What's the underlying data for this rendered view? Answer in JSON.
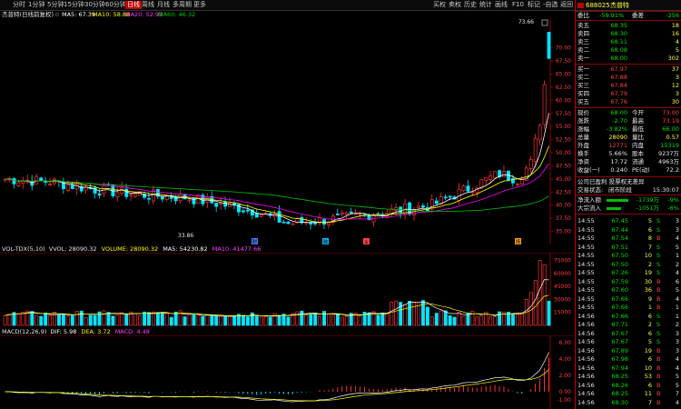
{
  "topbar": {
    "left": [
      "分时",
      "1分钟",
      "5分钟",
      "15分钟",
      "30分钟",
      "60分钟",
      "日线",
      "周线",
      "月线",
      "多周期",
      "更多"
    ],
    "selected": "日线",
    "right": [
      "买权",
      "卖权",
      "历史",
      "统计",
      "画线",
      "F10",
      "标记",
      "-自选",
      "返回"
    ]
  },
  "title": {
    "stock": "杰普特(日线前复权)",
    "ma5": "MA5: 67.39",
    "ma10": "MA10: 58.88",
    "ma20": "MA20: 52.93",
    "ma60": "MA60: 46.32"
  },
  "price_axis": [
    "70.00",
    "67.50",
    "65.00",
    "62.50",
    "60.00",
    "57.50",
    "55.00",
    "52.50",
    "50.00",
    "47.50",
    "45.00",
    "42.50",
    "40.00",
    "37.50",
    "35.00"
  ],
  "price_annotations": {
    "high": "73.66",
    "low": "33.86"
  },
  "markers": {
    "a": "财",
    "b": "融",
    "c": "$",
    "d": "扬"
  },
  "volume": {
    "label_main": "VOL-TDX(5,10)",
    "vvol": "VVOL: 28090.32",
    "volume": "VOLUME: 28090.32",
    "ma5": "MA5: 54230.82",
    "ma10": "MA10: 41477.66",
    "axis": [
      "75000",
      "60000",
      "45000",
      "30000",
      "15000"
    ]
  },
  "macd": {
    "label_main": "MACD(12,26,9)",
    "dif": "DIF: 5.98",
    "dea": "DEA: 3.72",
    "macd": "MACD: 4.48",
    "axis": [
      "6.00",
      "4.00",
      "2.00",
      "0.00",
      "-1.00"
    ]
  },
  "quote": {
    "code": "688025",
    "name": "杰普特",
    "webi_label": "委比",
    "webi_value": "-59.91%",
    "weicha_label": "委差",
    "weicha_value": "-256",
    "asks": [
      {
        "label": "卖五",
        "price": "68.35",
        "vol": "18"
      },
      {
        "label": "卖四",
        "price": "68.30",
        "vol": "16"
      },
      {
        "label": "卖三",
        "price": "68.11",
        "vol": "4"
      },
      {
        "label": "卖二",
        "price": "68.08",
        "vol": "5"
      },
      {
        "label": "卖一",
        "price": "68.00",
        "vol": "302"
      }
    ],
    "bids": [
      {
        "label": "买一",
        "price": "67.97",
        "vol": "37"
      },
      {
        "label": "买二",
        "price": "67.88",
        "vol": "3"
      },
      {
        "label": "买三",
        "price": "67.84",
        "vol": "12"
      },
      {
        "label": "买四",
        "price": "67.79",
        "vol": "3"
      },
      {
        "label": "买五",
        "price": "67.76",
        "vol": "30"
      }
    ],
    "stats": [
      {
        "l1": "现价",
        "v1": "68.00",
        "l2": "今开",
        "v2": "73.00"
      },
      {
        "l1": "涨跌",
        "v1": "-2.70",
        "l2": "最高",
        "v2": "73.19"
      },
      {
        "l1": "涨幅",
        "v1": "-3.82%",
        "l2": "最低",
        "v2": "66.00"
      },
      {
        "l1": "总量",
        "v1": "28090",
        "l2": "量比",
        "v2": "0.57"
      },
      {
        "l1": "外盘",
        "v1": "12771",
        "l2": "内盘",
        "v2": "15319"
      },
      {
        "l1": "换手",
        "v1": "5.66%",
        "l2": "股本",
        "v2": "9237万"
      },
      {
        "l1": "净资",
        "v1": "17.72",
        "l2": "流通",
        "v2": "4963万"
      },
      {
        "l1": "收益(一)",
        "v1": "0.240",
        "l2": "PE(动)",
        "v2": "72.2"
      }
    ],
    "notice": "公司已盈利 投票权无差异",
    "status_label": "交易状态:",
    "status": "闭市阶段",
    "status_time": "15:30:07",
    "inflow1_label": "净流入额",
    "inflow1_val": "-1739万",
    "inflow1_pct": "-9%",
    "inflow2_label": "大宗流入",
    "inflow2_val": "-1051万",
    "inflow2_pct": "-6%"
  },
  "ticks": [
    {
      "t": "14:55",
      "p": "67.45",
      "v": "5",
      "s": "S",
      "n": "3"
    },
    {
      "t": "14:55",
      "p": "67.44",
      "v": "6",
      "s": "S",
      "n": "3"
    },
    {
      "t": "14:55",
      "p": "67.54",
      "v": "8",
      "s": "B",
      "n": "4"
    },
    {
      "t": "14:55",
      "p": "67.51",
      "v": "7",
      "s": "S",
      "n": "5"
    },
    {
      "t": "14:55",
      "p": "67.50",
      "v": "10",
      "s": "S",
      "n": "1"
    },
    {
      "t": "14:55",
      "p": "67.50",
      "v": "2",
      "s": "S",
      "n": "2"
    },
    {
      "t": "14:55",
      "p": "67.26",
      "v": "19",
      "s": "S",
      "n": "4"
    },
    {
      "t": "14:55",
      "p": "67.59",
      "v": "30",
      "s": "B",
      "n": "6"
    },
    {
      "t": "14:55",
      "p": "67.60",
      "v": "36",
      "s": "B",
      "n": "5"
    },
    {
      "t": "14:55",
      "p": "67.66",
      "v": "9",
      "s": "B",
      "n": "4"
    },
    {
      "t": "14:55",
      "p": "67.66",
      "v": "1",
      "s": "B",
      "n": "1"
    },
    {
      "t": "14:56",
      "p": "67.66",
      "v": "6",
      "s": "S",
      "n": "1"
    },
    {
      "t": "14:56",
      "p": "67.71",
      "v": "2",
      "s": "S",
      "n": "2"
    },
    {
      "t": "14:56",
      "p": "67.67",
      "v": "6",
      "s": "S",
      "n": "3"
    },
    {
      "t": "14:56",
      "p": "67.67",
      "v": "5",
      "s": "S",
      "n": "3"
    },
    {
      "t": "14:56",
      "p": "67.89",
      "v": "19",
      "s": "B",
      "n": "3"
    },
    {
      "t": "14:56",
      "p": "67.98",
      "v": "6",
      "s": "B",
      "n": "4"
    },
    {
      "t": "14:56",
      "p": "67.94",
      "v": "10",
      "s": "B",
      "n": "4"
    },
    {
      "t": "14:56",
      "p": "68.25",
      "v": "53",
      "s": "B",
      "n": "5"
    },
    {
      "t": "14:56",
      "p": "68.26",
      "v": "6",
      "s": "B",
      "n": "5"
    },
    {
      "t": "14:56",
      "p": "68.25",
      "v": "11",
      "s": "B",
      "n": "7"
    },
    {
      "t": "14:56",
      "p": "68.30",
      "v": "7",
      "s": "B",
      "n": "4"
    }
  ],
  "colors": {
    "up": "#ff3030",
    "down": "#00e5ff",
    "ma5": "#ffffff",
    "ma10": "#ffff00",
    "ma20": "#ff00ff",
    "ma60": "#00c000",
    "grid": "#8b0000"
  }
}
